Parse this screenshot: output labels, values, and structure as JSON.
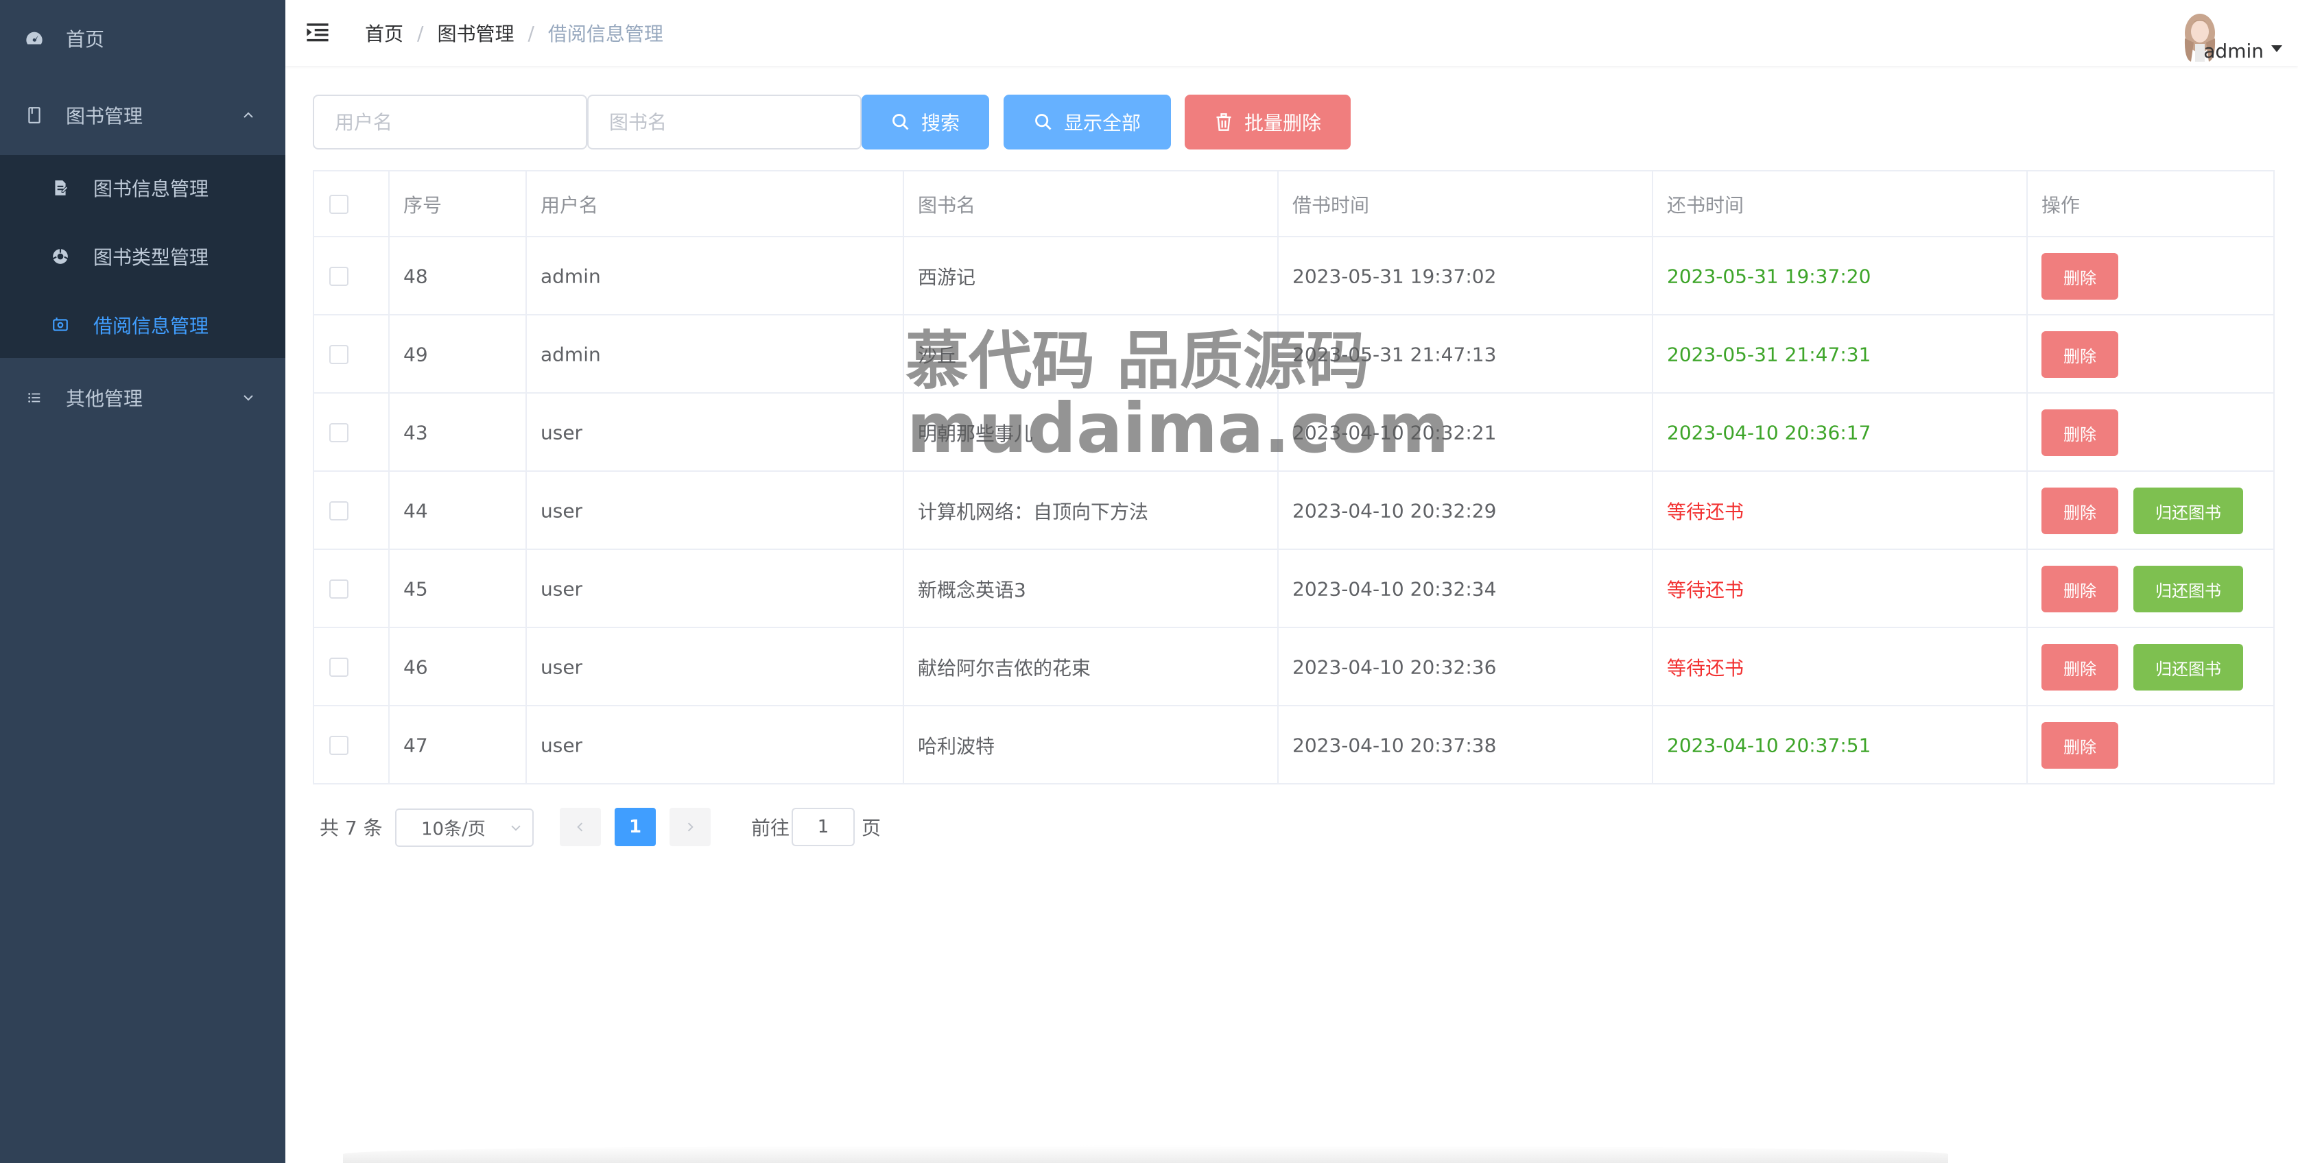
{
  "sidebar": {
    "items": [
      {
        "label": "首页",
        "icon": "dashboard-icon"
      },
      {
        "label": "图书管理",
        "icon": "book-icon",
        "expanded": true
      },
      {
        "label": "图书信息管理",
        "icon": "document-icon"
      },
      {
        "label": "图书类型管理",
        "icon": "category-icon"
      },
      {
        "label": "借阅信息管理",
        "icon": "borrow-icon",
        "active": true
      },
      {
        "label": "其他管理",
        "icon": "list-icon",
        "expanded": false
      }
    ]
  },
  "header": {
    "breadcrumb": [
      "首页",
      "图书管理",
      "借阅信息管理"
    ],
    "user_name": "admin"
  },
  "toolbar": {
    "username_placeholder": "用户名",
    "bookname_placeholder": "图书名",
    "search_label": "搜索",
    "show_all_label": "显示全部",
    "batch_delete_label": "批量删除"
  },
  "table": {
    "columns": [
      "序号",
      "用户名",
      "图书名",
      "借书时间",
      "还书时间",
      "操作"
    ],
    "delete_label": "删除",
    "return_label": "归还图书",
    "rows": [
      {
        "id": "48",
        "user": "admin",
        "book": "西游记",
        "borrow_time": "2023-05-31 19:37:02",
        "return_time": "2023-05-31 19:37:20",
        "returned": true
      },
      {
        "id": "49",
        "user": "admin",
        "book": "沙丘",
        "borrow_time": "2023-05-31 21:47:13",
        "return_time": "2023-05-31 21:47:31",
        "returned": true
      },
      {
        "id": "43",
        "user": "user",
        "book": "明朝那些事儿",
        "borrow_time": "2023-04-10 20:32:21",
        "return_time": "2023-04-10 20:36:17",
        "returned": true
      },
      {
        "id": "44",
        "user": "user",
        "book": "计算机网络：自顶向下方法",
        "borrow_time": "2023-04-10 20:32:29",
        "return_time": "等待还书",
        "returned": false
      },
      {
        "id": "45",
        "user": "user",
        "book": "新概念英语3",
        "borrow_time": "2023-04-10 20:32:34",
        "return_time": "等待还书",
        "returned": false
      },
      {
        "id": "46",
        "user": "user",
        "book": "献给阿尔吉侬的花束",
        "borrow_time": "2023-04-10 20:32:36",
        "return_time": "等待还书",
        "returned": false
      },
      {
        "id": "47",
        "user": "user",
        "book": "哈利波特",
        "borrow_time": "2023-04-10 20:37:38",
        "return_time": "2023-04-10 20:37:51",
        "returned": true
      }
    ]
  },
  "pagination": {
    "total_text": "共 7 条",
    "page_size": "10条/页",
    "current_page": "1",
    "goto_prefix": "前往",
    "goto_value": "1",
    "goto_suffix": "页"
  },
  "watermark": {
    "line1": "慕代码 品质源码",
    "line2": "mudaima.com"
  },
  "colors": {
    "sidebar_bg": "#304156",
    "submenu_bg": "#1f2d3d",
    "active": "#409eff",
    "primary_button": "#66b1ff",
    "danger_button": "#f07e7e",
    "success_button": "#7ec050",
    "returned_text": "#3ea52a",
    "pending_text": "#f23030"
  }
}
